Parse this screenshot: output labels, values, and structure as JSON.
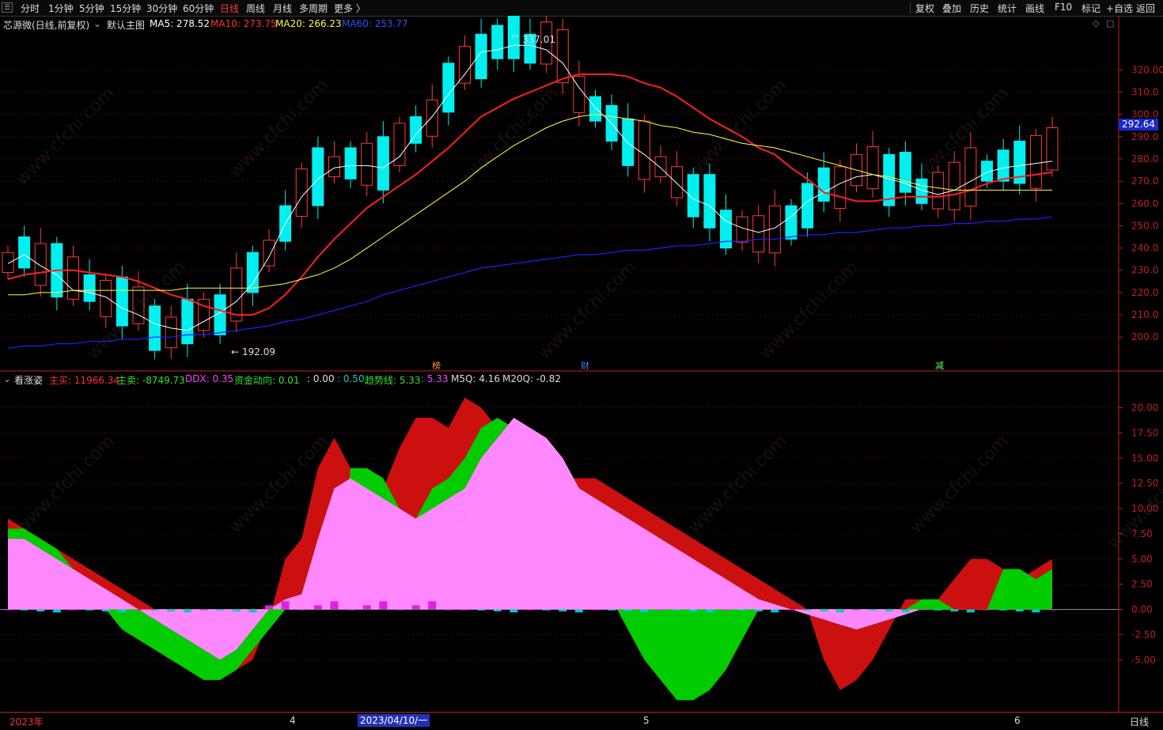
{
  "toolbar": {
    "menu_icon": "menu-icon",
    "periods": [
      "分时",
      "1分钟",
      "5分钟",
      "15分钟",
      "30分钟",
      "60分钟",
      "日线",
      "周线",
      "月线",
      "多周期",
      "更多 〉"
    ],
    "active_period": "日线",
    "tools": [
      "复权",
      "叠加",
      "历史",
      "统计",
      "画线",
      "F10",
      "标记",
      "+自选",
      "返回"
    ]
  },
  "main_panel": {
    "stock_name": "芯源微(日线,前复权)",
    "template": "默认主图",
    "ma5": "MA5: 278.52",
    "ma10": "MA10: 273.75",
    "ma20": "MA20: 266.23",
    "ma60": "MA60: 253.77",
    "high_label": "337.01",
    "low_label": "192.09",
    "current_price": "292.64",
    "event_marks": [
      "榜",
      "财",
      "减"
    ],
    "price_ticks": [
      "320.00",
      "310.0",
      "300.0",
      "290.0",
      "280.0",
      "270.0",
      "260.0",
      "250.0",
      "240.0",
      "230.0",
      "220.0",
      "210.0",
      "200.0"
    ]
  },
  "sub_panel": {
    "name": "看涨姿",
    "zhumai": "主买: 11966.34",
    "zhumai2": "主卖: -8749.73",
    "ddx": "DDX: 0.35",
    "zijin": "资金动向: 0.01",
    "val1": ": 0.00",
    "val2": ": 0.50",
    "trend": "趋势线: 5.33",
    "trend2": ": 5.33",
    "m5q": "M5Q: 4.16",
    "m20q": "M20Q: -0.82",
    "ticks": [
      "20.00",
      "17.50",
      "15.00",
      "12.50",
      "10.00",
      "7.50",
      "5.00",
      "2.50",
      "0.00",
      "-2.50",
      "-5.00"
    ]
  },
  "bottom": {
    "year": "2023年",
    "month4": "4",
    "month5": "5",
    "month6": "6",
    "cursor_date": "2023/04/10/一",
    "period_label": "日线"
  },
  "watermark": "www.cfchi.com",
  "colors": {
    "up": "#ff3a3a",
    "down": "#00f0f0",
    "ma5": "#ffffff",
    "ma10": "#ff2020",
    "ma20": "#ffff40",
    "ma60": "#2020ff",
    "pink": "#ff88ff",
    "green": "#00cc00",
    "darkred": "#6e0000",
    "red": "#cc1010"
  },
  "chart_data": [
    {
      "type": "candlestick",
      "title": "芯源微(日线,前复权)",
      "ylim": [
        188,
        340
      ],
      "series": [
        {
          "name": "MA5",
          "values": [
            233,
            237,
            232,
            228,
            221,
            220,
            218,
            213,
            210,
            206,
            204,
            203,
            207,
            211,
            216,
            224,
            236,
            251,
            263,
            271,
            276,
            277,
            277,
            276,
            281,
            291,
            299,
            309,
            318,
            328,
            329,
            331,
            331,
            329,
            323,
            312,
            303,
            296,
            287,
            282,
            276,
            269,
            262,
            259,
            252,
            249,
            247,
            249,
            254,
            261,
            265,
            269,
            272,
            273,
            271,
            269,
            266,
            264,
            266,
            270,
            274,
            276,
            277,
            278,
            279
          ]
        },
        {
          "name": "MA10",
          "values": [
            226,
            228,
            229,
            230,
            230,
            229,
            228,
            227,
            225,
            222,
            219,
            217,
            214,
            212,
            210,
            210,
            213,
            219,
            227,
            236,
            244,
            251,
            258,
            263,
            268,
            273,
            279,
            285,
            292,
            299,
            303,
            307,
            310,
            313,
            316,
            318,
            318,
            318,
            317,
            314,
            312,
            308,
            303,
            298,
            294,
            290,
            285,
            282,
            276,
            271,
            265,
            263,
            261,
            261,
            262,
            263,
            263,
            263,
            264,
            266,
            269,
            271,
            272,
            273,
            274
          ]
        },
        {
          "name": "MA20",
          "values": [
            219,
            219,
            220,
            220,
            221,
            221,
            221,
            221,
            221,
            221,
            221,
            222,
            222,
            222,
            222,
            222,
            223,
            224,
            226,
            228,
            231,
            235,
            240,
            245,
            250,
            255,
            260,
            265,
            270,
            276,
            281,
            286,
            290,
            294,
            297,
            299,
            300,
            299,
            298,
            297,
            295,
            294,
            292,
            291,
            289,
            287,
            286,
            285,
            283,
            281,
            279,
            277,
            275,
            273,
            272,
            270,
            268,
            267,
            266,
            266,
            266,
            266,
            266,
            266,
            266
          ]
        },
        {
          "name": "MA60",
          "values": [
            195,
            196,
            196,
            197,
            197,
            198,
            198,
            199,
            199,
            200,
            200,
            201,
            201,
            202,
            203,
            204,
            205,
            207,
            208,
            210,
            212,
            214,
            216,
            219,
            221,
            223,
            225,
            227,
            229,
            231,
            232,
            233,
            234,
            235,
            236,
            237,
            237,
            238,
            239,
            239,
            240,
            241,
            241,
            242,
            243,
            243,
            244,
            244,
            245,
            246,
            246,
            247,
            247,
            248,
            249,
            249,
            250,
            250,
            251,
            251,
            252,
            252,
            253,
            253,
            254
          ]
        }
      ]
    },
    {
      "type": "area",
      "title": "看涨姿",
      "ylim": [
        -10,
        22
      ],
      "series": [
        {
          "name": "pink",
          "values": [
            7,
            7,
            6,
            5,
            4,
            3,
            2,
            1,
            0,
            -1,
            -2,
            -3,
            -4,
            -5,
            -4,
            -2,
            0,
            1,
            1.5,
            7,
            12,
            13,
            12,
            11,
            10,
            9,
            10,
            11,
            12,
            15,
            17,
            19,
            18,
            17,
            15,
            12,
            11,
            10,
            9,
            8,
            7,
            6,
            5,
            4,
            3,
            2,
            1,
            0.5,
            0,
            -0.5,
            -1,
            -1.5,
            -2,
            -1.5,
            -1,
            -0.5,
            0,
            0,
            0,
            0,
            0,
            0,
            0,
            0,
            0
          ]
        },
        {
          "name": "green",
          "values": [
            8,
            8,
            7,
            6,
            4,
            2,
            0,
            -2,
            -3,
            -4,
            -5,
            -6,
            -7,
            -7,
            -6,
            -4,
            -2,
            0,
            0,
            0,
            0,
            14,
            14,
            13,
            10,
            9,
            12,
            13,
            15,
            18,
            19,
            18,
            16,
            12,
            9,
            7,
            4,
            1,
            -2,
            -5,
            -7,
            -9,
            -9,
            -8,
            -6,
            -3,
            0,
            0,
            0,
            0,
            0,
            0,
            0,
            0,
            0,
            0,
            1,
            1,
            0,
            0,
            0,
            4,
            4,
            3,
            4
          ]
        },
        {
          "name": "red",
          "values": [
            9,
            8,
            7,
            6,
            5,
            4,
            3,
            2,
            1,
            0,
            -1,
            -2,
            -3,
            -4,
            -6,
            -5,
            -1,
            5,
            7,
            14,
            17,
            14,
            12,
            12,
            16,
            19,
            19,
            18,
            21,
            20,
            18,
            17,
            16,
            15,
            13,
            13,
            13,
            12,
            11,
            10,
            9,
            8,
            7,
            6,
            5,
            4,
            3,
            2,
            1,
            0,
            -5,
            -8,
            -7,
            -5,
            -2,
            1,
            1,
            1,
            3,
            5,
            5,
            4,
            3,
            4,
            5
          ]
        }
      ]
    }
  ]
}
